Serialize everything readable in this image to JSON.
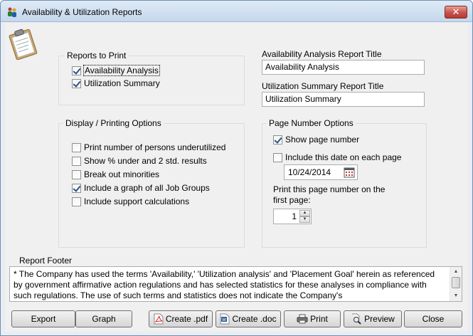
{
  "window": {
    "title": "Availability & Utilization Reports"
  },
  "reports_to_print": {
    "title": "Reports to Print",
    "items": [
      {
        "label": "Availability Analysis",
        "checked": true
      },
      {
        "label": "Utilization Summary",
        "checked": true
      }
    ]
  },
  "availability_title": {
    "label": "Availability Analysis Report Title",
    "value": "Availability Analysis"
  },
  "utilization_title": {
    "label": "Utilization Summary Report Title",
    "value": "Utilization Summary"
  },
  "display_options": {
    "title": "Display / Printing Options",
    "items": [
      {
        "label": "Print number of persons underutilized",
        "checked": false
      },
      {
        "label": "Show % under and 2 std. results",
        "checked": false
      },
      {
        "label": "Break out minorities",
        "checked": false
      },
      {
        "label": "Include a graph of all Job Groups",
        "checked": true
      },
      {
        "label": "Include support calculations",
        "checked": false
      }
    ]
  },
  "page_number_options": {
    "title": "Page Number Options",
    "show_page_number": {
      "label": "Show page number",
      "checked": true
    },
    "include_date": {
      "label": "Include this date on each page",
      "checked": false
    },
    "date_value": "10/24/2014",
    "first_page_label_line1": "Print this page number on the",
    "first_page_label_line2": "first page:",
    "first_page_value": "1"
  },
  "report_footer": {
    "label": "Report Footer",
    "text": "* The Company has used the terms 'Availability,' 'Utilization analysis' and 'Placement Goal' herein as referenced by government affirmative action regulations and has selected statistics for these analyses in compliance with such regulations. The use of such terms and statistics does not indicate the Company's"
  },
  "buttons": {
    "export": "Export",
    "graph": "Graph",
    "create_pdf": "Create .pdf",
    "create_doc": "Create .doc",
    "print": "Print",
    "preview": "Preview",
    "close": "Close"
  },
  "icons": {
    "app": "people-icon",
    "clipboard": "clipboard-icon",
    "calendar": "calendar-icon",
    "pdf": "pdf-icon",
    "doc": "word-doc-icon",
    "print": "printer-icon",
    "preview": "magnifier-icon"
  },
  "colors": {
    "title_bar": "#c5d7ec",
    "close_button": "#c75050",
    "client_bg": "#f0f0f0",
    "check_mark": "#2a4f8a"
  }
}
